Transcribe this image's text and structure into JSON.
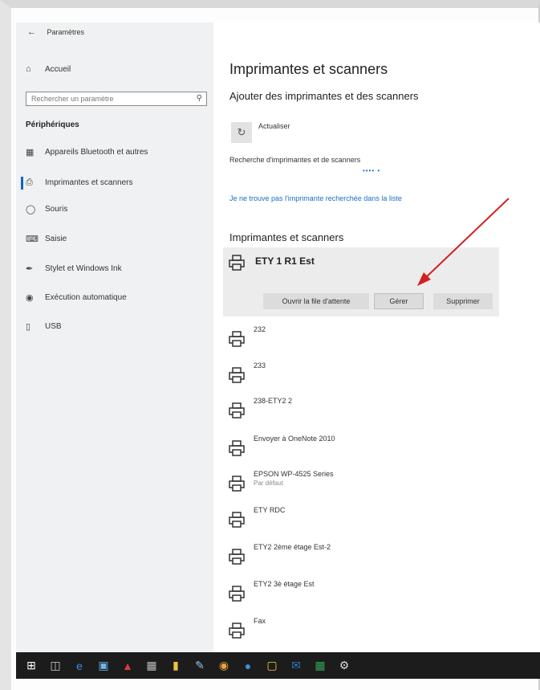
{
  "window": {
    "title": "Paramètres"
  },
  "sidebar": {
    "home_label": "Accueil",
    "search_placeholder": "Rechercher un paramètre",
    "section_label": "Périphériques",
    "items": [
      {
        "label": "Appareils Bluetooth et autres",
        "icon": "bluetooth-devices-icon"
      },
      {
        "label": "Imprimantes et scanners",
        "icon": "printer-icon"
      },
      {
        "label": "Souris",
        "icon": "mouse-icon"
      },
      {
        "label": "Saisie",
        "icon": "keyboard-icon"
      },
      {
        "label": "Stylet et Windows Ink",
        "icon": "pen-icon"
      },
      {
        "label": "Exécution automatique",
        "icon": "autoplay-icon"
      },
      {
        "label": "USB",
        "icon": "usb-icon"
      }
    ]
  },
  "main": {
    "title": "Imprimantes et scanners",
    "add_heading": "Ajouter des imprimantes et des scanners",
    "refresh_label": "Actualiser",
    "search_status": "Recherche d'imprimantes et de scanners",
    "not_listed_link": "Je ne trouve pas l'imprimante recherchée dans la liste",
    "printers_heading": "Imprimantes et scanners",
    "selected_printer": {
      "name": "ETY 1 R1 Est",
      "open_queue": "Ouvrir la file d'attente",
      "manage": "Gérer",
      "remove": "Supprimer"
    },
    "printers": [
      {
        "name": "232"
      },
      {
        "name": "233"
      },
      {
        "name": "238-ETY2 2"
      },
      {
        "name": "Envoyer à OneNote 2010"
      },
      {
        "name": "EPSON WP-4525 Series",
        "sub": "Par défaut"
      },
      {
        "name": "ETY RDC"
      },
      {
        "name": "ETY2 2ème étage Est-2"
      },
      {
        "name": "ETY2 3è étage Est"
      },
      {
        "name": "Fax"
      }
    ]
  },
  "annotation": {
    "arrow_color": "#d42020"
  },
  "colors": {
    "accent": "#0a67c7",
    "link": "#1a6ec8",
    "sidebar_bg": "#f0f1f2",
    "taskbar_bg": "#1c1c1c"
  },
  "taskbar": {
    "items": [
      "start-icon",
      "task-view-icon",
      "edge-icon",
      "store-icon",
      "acrobat-icon",
      "calculator-icon",
      "explorer-icon",
      "paint-icon",
      "chrome-icon",
      "app-icon",
      "sticky-notes-icon",
      "outlook-icon",
      "excel-icon",
      "settings-icon"
    ]
  }
}
